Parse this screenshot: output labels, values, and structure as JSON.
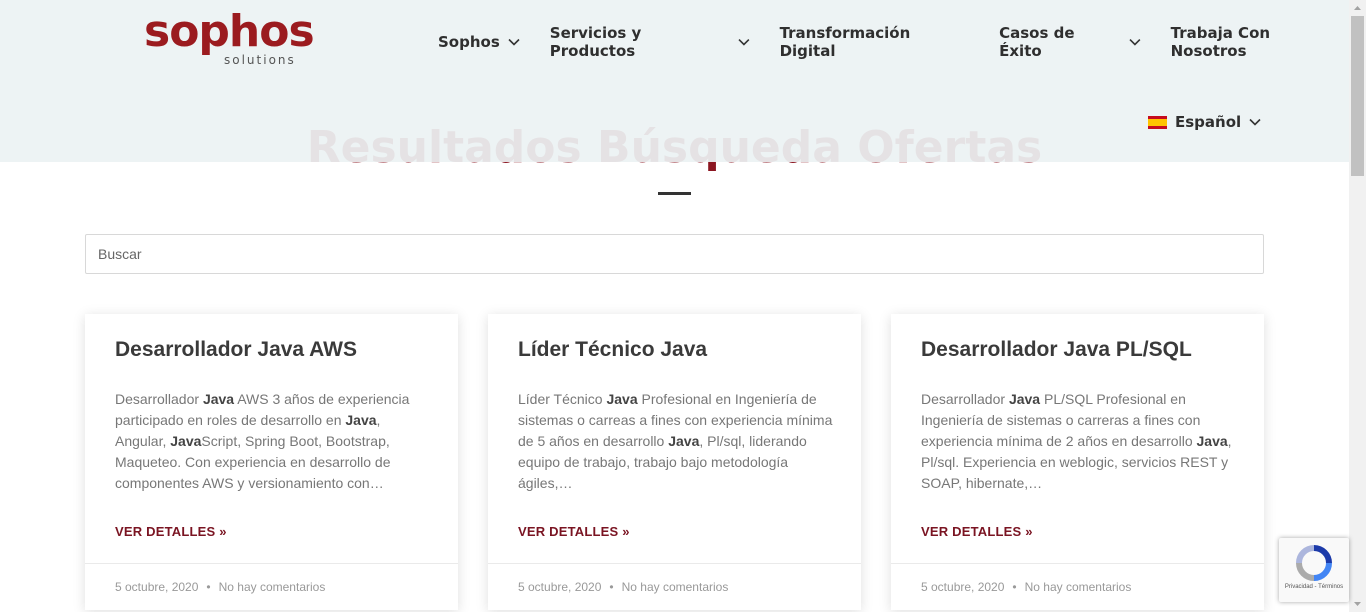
{
  "header": {
    "logo": {
      "word": "sophos",
      "sub": "solutions"
    },
    "nav": [
      {
        "label": "Sophos",
        "dropdown": true
      },
      {
        "label": "Servicios y Productos",
        "dropdown": true
      },
      {
        "label": "Transformación Digital",
        "dropdown": false
      },
      {
        "label": "Casos de Éxito",
        "dropdown": true
      },
      {
        "label": "Trabaja Con Nosotros",
        "dropdown": false
      }
    ],
    "language": {
      "label": "Español",
      "flag": "spain-flag-icon"
    }
  },
  "page": {
    "title": "Resultados Búsqueda Ofertas"
  },
  "search": {
    "placeholder": "Buscar",
    "value": ""
  },
  "cards": [
    {
      "title": "Desarrollador Java AWS",
      "excerpt_html": "Desarrollador <b>Java</b> AWS 3 años de experiencia participado en roles de desarrollo en <b>Java</b>, Angular, <b>Java</b>Script, Spring Boot, Bootstrap, Maqueteo. Con experiencia en desarrollo de componentes AWS y versionamiento con…",
      "link": "VER DETALLES »",
      "date": "5 octubre, 2020",
      "comments": "No hay comentarios"
    },
    {
      "title": "Líder Técnico Java",
      "excerpt_html": "Líder Técnico <b>Java</b> Profesional en Ingeniería de sistemas o carreas a fines con experiencia mínima de 5 años en desarrollo <b>Java</b>, Pl/sql, liderando equipo de trabajo, trabajo bajo metodología ágiles,…",
      "link": "VER DETALLES »",
      "date": "5 octubre, 2020",
      "comments": "No hay comentarios"
    },
    {
      "title": "Desarrollador Java PL/SQL",
      "excerpt_html": "Desarrollador <b>Java</b> PL/SQL Profesional en Ingeniería de sistemas o carreras a fines con experiencia mínima de 2 años en desarrollo <b>Java</b>, Pl/sql. Experiencia en weblogic, servicios REST y SOAP, hibernate,…",
      "link": "VER DETALLES »",
      "date": "5 octubre, 2020",
      "comments": "No hay comentarios"
    }
  ],
  "recaptcha": {
    "text": "Privacidad - Términos"
  },
  "colors": {
    "brand": "#9b1b1f",
    "link": "#7a1422",
    "header_bg": "#ecf2f3"
  }
}
